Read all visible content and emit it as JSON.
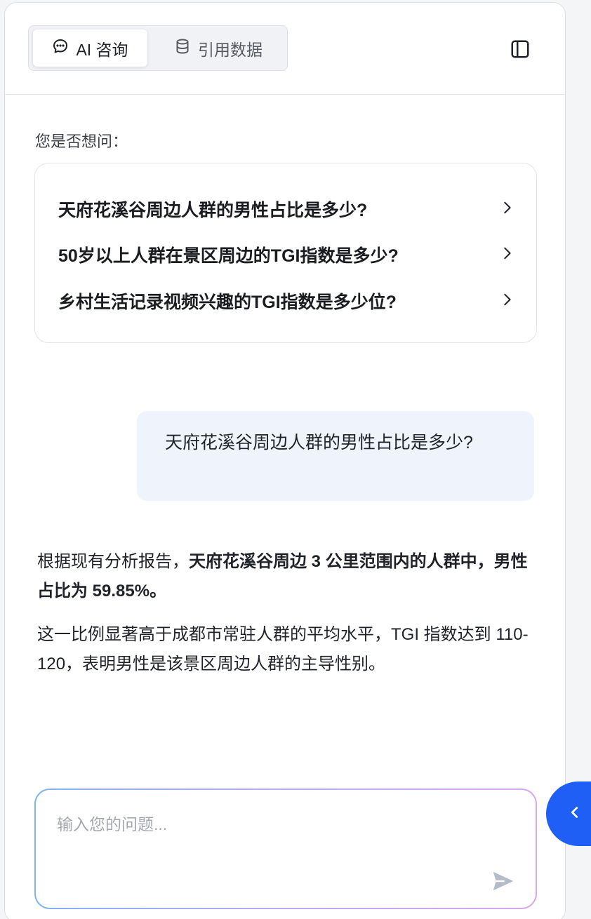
{
  "tabs": [
    {
      "label": "AI 咨询",
      "icon": "chat-bubble-icon",
      "active": true
    },
    {
      "label": "引用数据",
      "icon": "database-icon",
      "active": false
    }
  ],
  "suggestions": {
    "title": "您是否想问：",
    "items": [
      "天府花溪谷周边人群的男性占比是多少?",
      "50岁以上人群在景区周边的TGI指数是多少?",
      "乡村生活记录视频兴趣的TGI指数是多少位?"
    ]
  },
  "user_message": "天府花溪谷周边人群的男性占比是多少?",
  "answer": {
    "p1_plain": "根据现有分析报告，",
    "p1_bold": "天府花溪谷周边 3 公里范围内的人群中，男性占比为 59.85%。",
    "p2": "这一比例显著高于成都市常驻人群的平均水平，TGI 指数达到 110-120，表明男性是该景区周边人群的主导性别。"
  },
  "input": {
    "placeholder": "输入您的问题...",
    "value": ""
  },
  "colors": {
    "accent": "#1f5ff5",
    "bubble": "#eff3fb",
    "border": "#dcdfe6"
  }
}
